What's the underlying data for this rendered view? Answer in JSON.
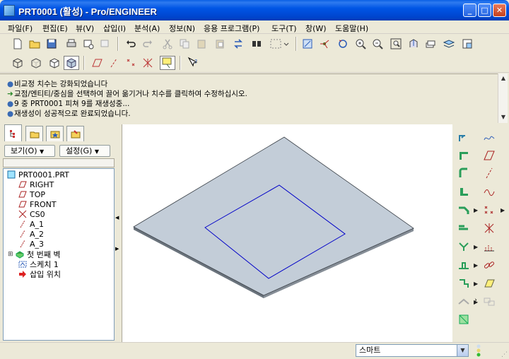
{
  "window": {
    "title": "PRT0001 (활성) - Pro/ENGINEER"
  },
  "menu": [
    "파일(F)",
    "편집(E)",
    "뷰(V)",
    "삽입(I)",
    "분석(A)",
    "정보(N)",
    "응용 프로그램(P)",
    "도구(T)",
    "창(W)",
    "도움말(H)"
  ],
  "messages": [
    "비교정 치수는 강화되었습니다",
    "교점/엔티티/중심을 선택하여 끌어 옮기거나 치수를 클릭하여 수정하십시오.",
    "9 중 PRT0001 피쳐 9를 재생성중...",
    "재생성이 성공적으로 완료되었습니다."
  ],
  "navigator": {
    "show_button": "보기(O)",
    "settings_button": "설정(G)",
    "tree": [
      {
        "label": "PRT0001.PRT",
        "icon": "part-icon"
      },
      {
        "label": "RIGHT",
        "icon": "datum-plane-icon"
      },
      {
        "label": "TOP",
        "icon": "datum-plane-icon"
      },
      {
        "label": "FRONT",
        "icon": "datum-plane-icon"
      },
      {
        "label": "CS0",
        "icon": "coordinate-system-icon"
      },
      {
        "label": "A_1",
        "icon": "datum-axis-icon"
      },
      {
        "label": "A_2",
        "icon": "datum-axis-icon"
      },
      {
        "label": "A_3",
        "icon": "datum-axis-icon"
      },
      {
        "label": "첫 번째 벽",
        "icon": "sheetmetal-wall-icon"
      },
      {
        "label": "스케치 1",
        "icon": "sketch-icon"
      },
      {
        "label": "삽입 위치",
        "icon": "insert-here-icon"
      }
    ]
  },
  "status": {
    "filter_value": "스마트"
  },
  "colors": {
    "part_face": "#c3cdd8",
    "part_edge": "#000000",
    "sketch": "#0000c8",
    "title_bar": "#0055e5"
  }
}
